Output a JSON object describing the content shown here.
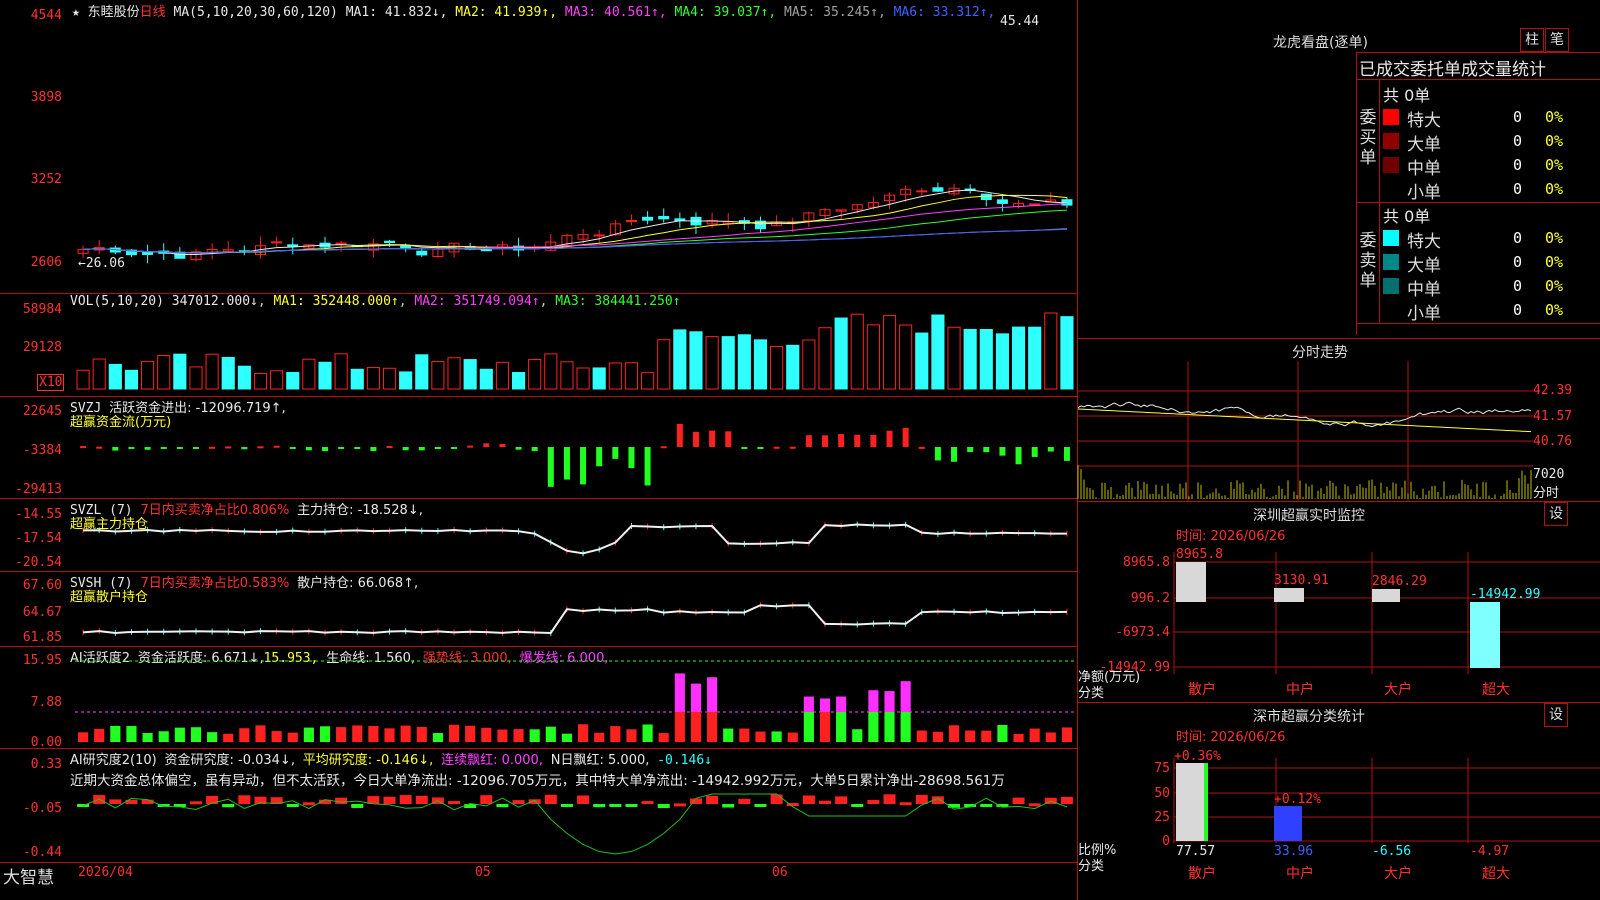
{
  "header": {
    "stock_name": "东睦股份",
    "period": "日线",
    "ma_def": "MA(5,10,20,30,60,120)",
    "ma": [
      {
        "label": "MA1: 41.832↓",
        "color": "#e8e8e8"
      },
      {
        "label": "MA2: 41.939↑",
        "color": "#ffff30"
      },
      {
        "label": "MA3: 40.561↑",
        "color": "#ff40ff"
      },
      {
        "label": "MA4: 39.037↑",
        "color": "#30ff30"
      },
      {
        "label": "MA5: 35.245↑",
        "color": "#a0a0a0"
      },
      {
        "label": "MA6: 33.312↑",
        "color": "#4060ff"
      }
    ],
    "high_mark": "45.44",
    "low_mark": "←26.06"
  },
  "price_axis": [
    "4544",
    "3898",
    "3252",
    "2606"
  ],
  "vol": {
    "def": "VOL(5,10,20)",
    "v": "347012.000↓",
    "ma1": "MA1: 352448.000↑",
    "ma2": "MA2: 351749.094↑",
    "ma3": "MA3: 384441.250↑",
    "axis": [
      "58984",
      "29128"
    ],
    "unit": "X10"
  },
  "svzj": {
    "name": "SVZJ",
    "label": "活跃资金进出: -12096.719↑,",
    "sub": "超赢资金流(万元)",
    "axis": [
      "22645",
      "-3384",
      "-29413"
    ]
  },
  "svzl": {
    "name": "SVZL (7)",
    "ratio": "7日内买卖净占比0.806%",
    "label": "主力持仓: -18.528↓,",
    "sub": "超赢主力持仓",
    "axis": [
      "-14.55",
      "-17.54",
      "-20.54"
    ]
  },
  "svsh": {
    "name": "SVSH (7)",
    "ratio": "7日内买卖净占比0.583%",
    "label": "散户持仓: 66.068↑,",
    "sub": "超赢散户持仓",
    "axis": [
      "67.60",
      "64.67",
      "61.85"
    ]
  },
  "ai1": {
    "name": "AI活跃度2",
    "a": "资金活跃度: 6.671↓,",
    "b": "15.953,",
    "c": "生命线: 1.560,",
    "d": "强势线: 3.000,",
    "e": "爆发线: 6.000,",
    "axis": [
      "15.95",
      "7.88",
      "0.00"
    ]
  },
  "ai2": {
    "name": "AI研究度2(10)",
    "a": "资金研究度: -0.034↓,",
    "b": "平均研究度: -0.146↓,",
    "c": "连续飘红: 0.000,",
    "d": "N日飘红: 5.000,",
    "e": "-0.146↓",
    "note": "近期大资金总体偏空，虽有异动，但不太活跃，今日大单净流出: -12096.705万元，其中特大单净流出: -14942.992万元，大单5日累计净出-28698.561万",
    "axis": [
      "0.33",
      "-0.05",
      "-0.44"
    ]
  },
  "bottom": {
    "brand": "大智慧",
    "dates": [
      "2026/04",
      "05",
      "06"
    ]
  },
  "lhb": {
    "title": "龙虎看盘(逐单)",
    "btn1": "柱",
    "btn2": "笔",
    "sub": "已成交委托单成交量统计",
    "buy": {
      "side": "委买单",
      "total": "共 0单",
      "rows": [
        {
          "name": "特大",
          "v": "0",
          "p": "0%",
          "c": "#ff0000"
        },
        {
          "name": "大单",
          "v": "0",
          "p": "0%",
          "c": "#900000"
        },
        {
          "name": "中单",
          "v": "0",
          "p": "0%",
          "c": "#700000"
        },
        {
          "name": "小单",
          "v": "0",
          "p": "0%",
          "c": ""
        }
      ]
    },
    "sell": {
      "side": "委卖单",
      "total": "共 0单",
      "rows": [
        {
          "name": "特大",
          "v": "0",
          "p": "0%",
          "c": "#00ffff"
        },
        {
          "name": "大单",
          "v": "0",
          "p": "0%",
          "c": "#008888"
        },
        {
          "name": "中单",
          "v": "0",
          "p": "0%",
          "c": "#007070"
        },
        {
          "name": "小单",
          "v": "0",
          "p": "0%",
          "c": ""
        }
      ]
    }
  },
  "fenshi": {
    "title": "分时走势",
    "axis": [
      "42.39",
      "41.57",
      "40.76"
    ],
    "vol": "7020",
    "tag": "分时"
  },
  "monitor": {
    "title": "深圳超赢实时监控",
    "btn": "设",
    "date": "时间: 2026/06/26",
    "axis": [
      "8965.8",
      "996.2",
      "-6973.4",
      "-14942.99"
    ],
    "ylab": "净额(万元)",
    "xlab": "分类",
    "cats": [
      "散户",
      "中户",
      "大户",
      "超大"
    ],
    "vals": [
      "8965.8",
      "3130.91",
      "2846.29",
      "-14942.99"
    ]
  },
  "stats": {
    "title": "深市超赢分类统计",
    "btn": "设",
    "date": "时间: 2026/06/26",
    "axis": [
      "75",
      "50",
      "25",
      "0"
    ],
    "ylab": "比例%",
    "xlab": "分类",
    "cats": [
      "散户",
      "中户",
      "大户",
      "超大"
    ],
    "vals": [
      "77.57",
      "33.96",
      "-6.56",
      "-4.97"
    ],
    "tops": [
      "+0.36%",
      "+0.12%"
    ]
  },
  "chart_data": {
    "type": "candlestick",
    "title": "东睦股份 日线",
    "ylim": [
      26.06,
      45.44
    ],
    "note": "daily candles Apr–Jun 2026"
  }
}
